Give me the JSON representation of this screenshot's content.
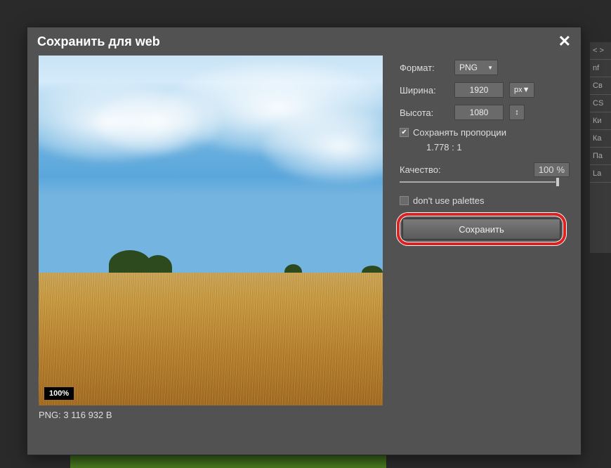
{
  "dialog": {
    "title": "Сохранить для web",
    "close_aria": "close"
  },
  "preview": {
    "zoom": "100%",
    "file_info": "PNG: 3 116 932 B"
  },
  "controls": {
    "format_label": "Формат:",
    "format_value": "PNG",
    "width_label": "Ширина:",
    "width_value": "1920",
    "width_unit": "px",
    "height_label": "Высота:",
    "height_value": "1080",
    "swap_icon": "↕",
    "keep_aspect_label": "Сохранять пропорции",
    "keep_aspect_checked": true,
    "aspect_ratio": "1.778 : 1",
    "quality_label": "Качество:",
    "quality_value": "100",
    "quality_unit": "%",
    "palettes_label": "don't use palettes",
    "palettes_checked": false,
    "save_label": "Сохранить"
  },
  "bg_tabs": [
    "< >",
    "nf",
    "Св",
    "CS",
    "Ки",
    "Ка",
    "Па",
    "La"
  ]
}
